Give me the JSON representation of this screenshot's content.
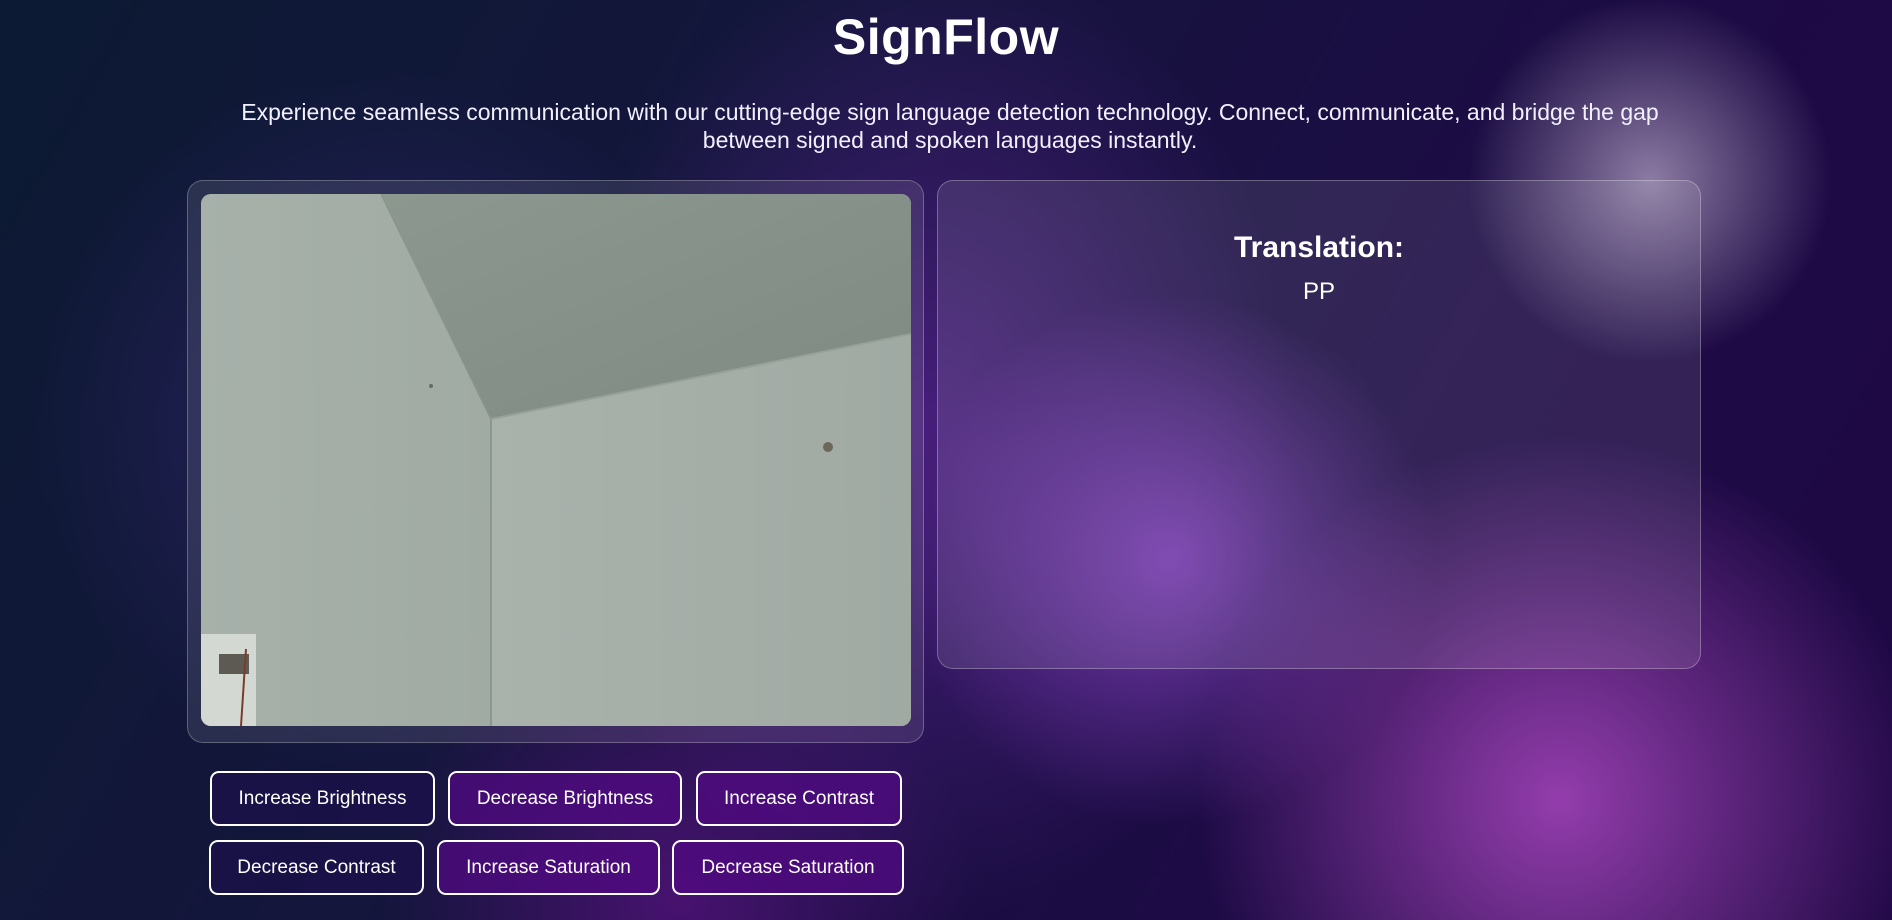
{
  "app": {
    "title": "SignFlow",
    "subtitle": "Experience seamless communication with our cutting-edge sign language detection technology. Connect, communicate, and bridge the gap between signed and spoken languages instantly."
  },
  "translation": {
    "label": "Translation:",
    "text": "PP"
  },
  "controls": {
    "increase_brightness": "Increase Brightness",
    "decrease_brightness": "Decrease Brightness",
    "increase_contrast": "Increase Contrast",
    "decrease_contrast": "Decrease Contrast",
    "increase_saturation": "Increase Saturation",
    "decrease_saturation": "Decrease Saturation"
  },
  "colors": {
    "background_dark": "#14163c",
    "accent_purple": "#8a3fb8",
    "button_border": "#ffffff"
  }
}
